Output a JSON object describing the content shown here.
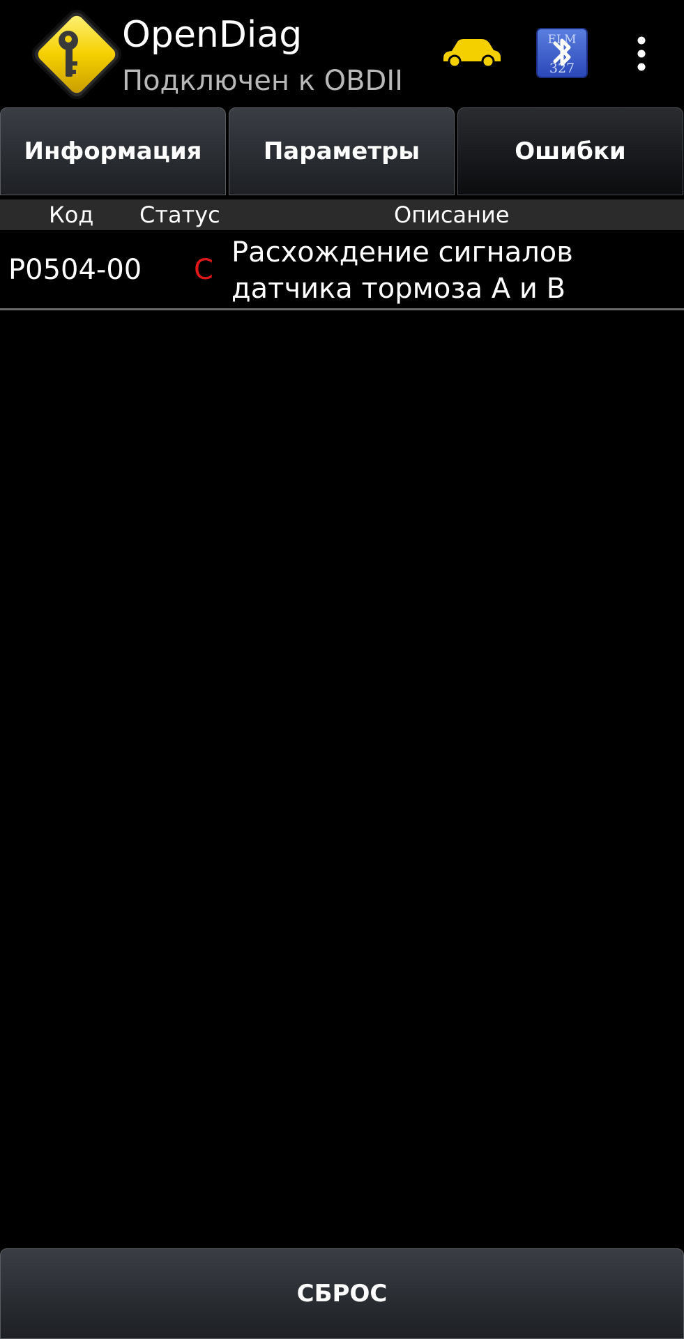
{
  "app": {
    "title": "OpenDiag",
    "subtitle": "Подключен к OBDII",
    "icons": [
      "key-diamond-logo",
      "car-icon",
      "bluetooth-elm327-icon",
      "overflow-menu-icon"
    ],
    "bluetooth_badge_text": [
      "ELM",
      "327"
    ],
    "accent": "#f5d000"
  },
  "tabs": [
    {
      "label": "Информация",
      "active": false
    },
    {
      "label": "Параметры",
      "active": false
    },
    {
      "label": "Ошибки",
      "active": true
    }
  ],
  "table": {
    "headers": {
      "code": "Код",
      "status": "Статус",
      "description": "Описание"
    },
    "rows": [
      {
        "code": "P0504-00",
        "status": "C",
        "description": "Расхождение сигналов датчика тормоза А и В"
      }
    ],
    "status_color": "#e01818"
  },
  "footer": {
    "reset_label": "СБРОС"
  }
}
